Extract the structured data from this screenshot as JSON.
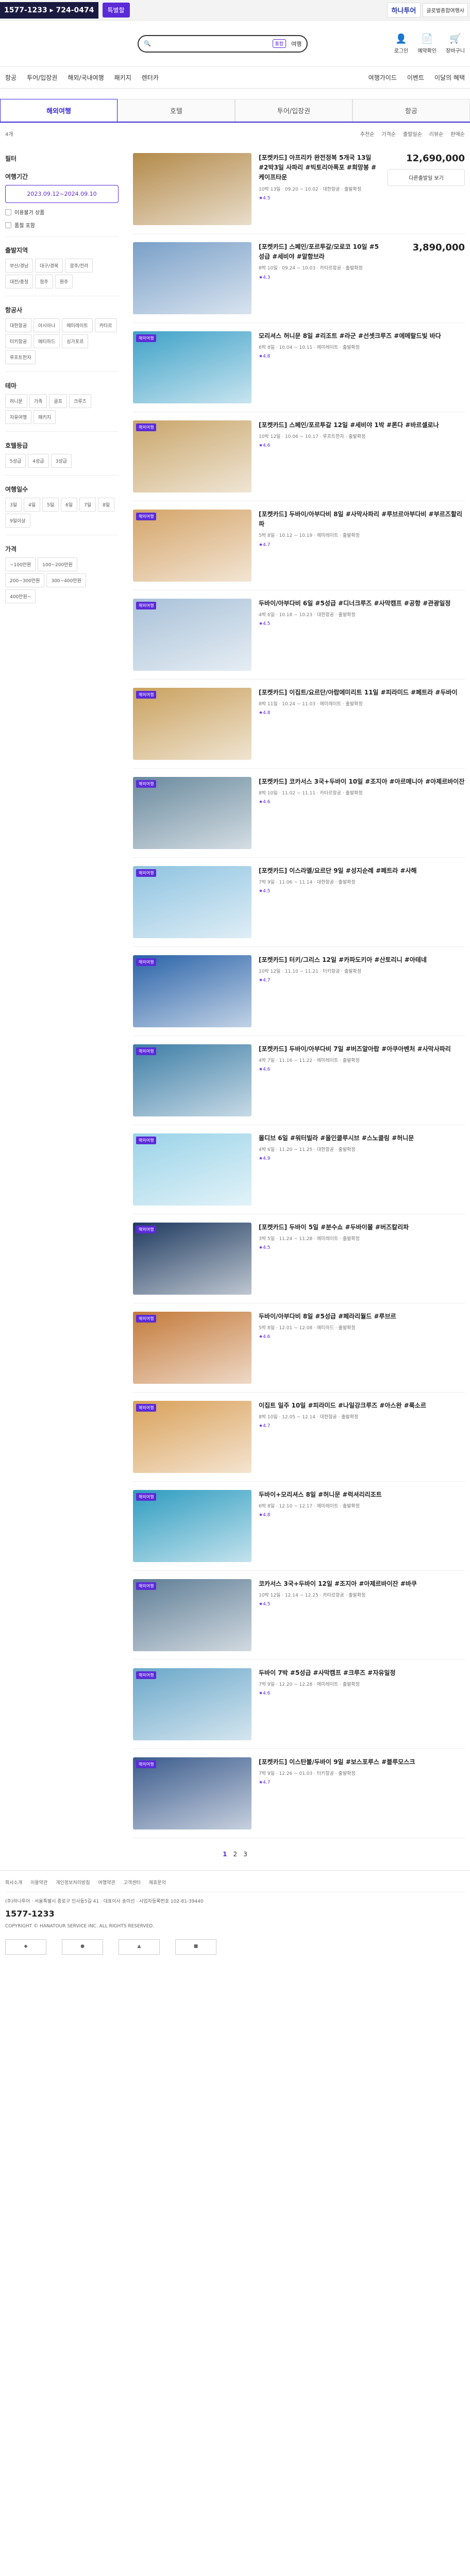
{
  "topbar": {
    "phone": "1577-1233 ▸ 724-0474",
    "special": "특별할",
    "hana": "하나투어",
    "corp": "글로벌종합여행사"
  },
  "header": {
    "search_placeholder": "",
    "mode": "통합",
    "mode_label": "여행",
    "icons": [
      {
        "name": "로그인",
        "icon": "user"
      },
      {
        "name": "예약확인",
        "icon": "doc"
      },
      {
        "name": "장바구니",
        "icon": "cart"
      }
    ]
  },
  "nav": {
    "left": [
      "항공",
      "투어/입장권",
      "해외/국내여행",
      "패키지",
      "렌터카"
    ],
    "right": [
      "여행가이드",
      "이벤트",
      "이달의 혜택"
    ]
  },
  "tabs": [
    "해외여행",
    "호텔",
    "투어/입장권",
    "항공"
  ],
  "breadcrumb": {
    "left": "4개",
    "right": [
      "추천순",
      "가격순",
      "출발일순",
      "리뷰순",
      "판매순"
    ]
  },
  "sidebar": {
    "title": "필터",
    "date_title": "여행기간",
    "date": "2023.09.12~2024.09.10",
    "exclude": "이용불가 상품",
    "soldout": "품절 포함",
    "region_title": "출발지역",
    "regions": [
      "부산/경남",
      "대구/경북",
      "광주/전라",
      "대전/충청",
      "청주",
      "원주"
    ],
    "airline_title": "항공사",
    "airlines": [
      "대한항공",
      "아시아나",
      "에미레이트",
      "카타르",
      "터키항공",
      "에티하드",
      "싱가포르",
      "루프트한자"
    ],
    "theme_title": "테마",
    "themes": [
      "허니문",
      "가족",
      "골프",
      "크루즈",
      "자유여행",
      "패키지"
    ],
    "hotel_title": "호텔등급",
    "hotels": [
      "5성급",
      "4성급",
      "3성급"
    ],
    "duration_title": "여행일수",
    "durations": [
      "3일",
      "4일",
      "5일",
      "6일",
      "7일",
      "8일",
      "9일이상"
    ],
    "price_title": "가격",
    "prices": [
      "~100만원",
      "100~200만원",
      "200~300만원",
      "300~400만원",
      "400만원~"
    ]
  },
  "cards": [
    {
      "title": "[포켓카드] 아프리카 완전정복 5개국 13일 #2박3일 사파리 #빅토리아폭포 #희망봉 #케이프타운",
      "meta": "10박 13일 · 09.20 ~ 10.02 · 대한항공 · 출발확정",
      "price": "12,690,000",
      "rate": "★4.5",
      "btn": "다른출발일 보기",
      "badge": "",
      "color": "#b38a4a"
    },
    {
      "title": "[포켓카드] 스페인/포르투갈/모로코 10일 #5성급 #세비야 #알함브라",
      "meta": "8박 10일 · 09.24 ~ 10.03 · 카타르항공 · 출발확정",
      "price": "3,890,000",
      "rate": "★4.3",
      "btn": "",
      "badge": "",
      "color": "#7aa0c8"
    },
    {
      "title": "모리셔스 허니문 8일 #리조트 #라군 #선셋크루즈 #에메랄드빛 바다",
      "meta": "6박 8일 · 10.04 ~ 10.11 · 에미레이트 · 출발확정",
      "price": "",
      "rate": "★4.8",
      "btn": "",
      "badge": "해외여행",
      "color": "#3fa2c8"
    },
    {
      "title": "[포켓카드] 스페인/포르투갈 12일 #세비야 1박 #론다 #바르셀로나",
      "meta": "10박 12일 · 10.06 ~ 10.17 · 루프트한자 · 출발확정",
      "price": "",
      "rate": "★4.6",
      "btn": "",
      "badge": "해외여행",
      "color": "#c9a66b"
    },
    {
      "title": "[포켓카드] 두바이/아부다비 8일 #사막사파리 #루브르아부다비 #부르즈할리파",
      "meta": "5박 8일 · 10.12 ~ 10.19 · 에미레이트 · 출발확정",
      "price": "",
      "rate": "★4.7",
      "btn": "",
      "badge": "해외여행",
      "color": "#d4a468"
    },
    {
      "title": "두바이/아부다비 6일 #5성급 #디너크루즈 #사막캠프 #공항 #관광일정",
      "meta": "4박 6일 · 10.18 ~ 10.23 · 대한항공 · 출발확정",
      "price": "",
      "rate": "★4.5",
      "btn": "",
      "badge": "해외여행",
      "color": "#a8c1d8"
    },
    {
      "title": "[포켓카드] 이집트/요르단/아랍에미리트 11일 #피라미드 #페트라 #두바이",
      "meta": "8박 11일 · 10.24 ~ 11.03 · 에미레이트 · 출발확정",
      "price": "",
      "rate": "★4.8",
      "btn": "",
      "badge": "해외여행",
      "color": "#c9a15e"
    },
    {
      "title": "[포켓카드] 코카서스 3국+두바이 10일 #조지아 #아르메니아 #아제르바이잔",
      "meta": "8박 10일 · 11.02 ~ 11.11 · 카타르항공 · 출발확정",
      "price": "",
      "rate": "★4.6",
      "btn": "",
      "badge": "해외여행",
      "color": "#6a8a9e"
    },
    {
      "title": "[포켓카드] 이스라엘/요르단 9일 #성지순례 #페트라 #사해",
      "meta": "7박 9일 · 11.06 ~ 11.14 · 대한항공 · 출발확정",
      "price": "",
      "rate": "★4.5",
      "btn": "",
      "badge": "해외여행",
      "color": "#8ec3e0"
    },
    {
      "title": "[포켓카드] 터키/그리스 12일 #카파도키아 #산토리니 #아테네",
      "meta": "10박 12일 · 11.10 ~ 11.21 · 터키항공 · 출발확정",
      "price": "",
      "rate": "★4.7",
      "btn": "",
      "badge": "해외여행",
      "color": "#2a63a8"
    },
    {
      "title": "[포켓카드] 두바이/아부다비 7일 #버즈알아랍 #아쿠아벤처 #사막사파리",
      "meta": "4박 7일 · 11.16 ~ 11.22 · 에미레이트 · 출발확정",
      "price": "",
      "rate": "★4.6",
      "btn": "",
      "badge": "해외여행",
      "color": "#3d7ea6"
    },
    {
      "title": "몰디브 6일 #워터빌라 #올인클루시브 #스노클링 #허니문",
      "meta": "4박 6일 · 11.20 ~ 11.25 · 대한항공 · 출발확정",
      "price": "",
      "rate": "★4.9",
      "btn": "",
      "badge": "해외여행",
      "color": "#9ad3e8"
    },
    {
      "title": "[포켓카드] 두바이 5일 #분수쇼 #두바이몰 #버즈칼리파",
      "meta": "3박 5일 · 11.24 ~ 11.28 · 에미레이트 · 출발확정",
      "price": "",
      "rate": "★4.5",
      "btn": "",
      "badge": "해외여행",
      "color": "#1e3a5f"
    },
    {
      "title": "두바이/아부다비 8일 #5성급 #페라리월드 #루브르",
      "meta": "5박 8일 · 12.01 ~ 12.08 · 에티하드 · 출발확정",
      "price": "",
      "rate": "★4.6",
      "btn": "",
      "badge": "해외여행",
      "color": "#c47a3a"
    },
    {
      "title": "이집트 일주 10일 #피라미드 #나일강크루즈 #아스완 #룩소르",
      "meta": "8박 10일 · 12.05 ~ 12.14 · 대한항공 · 출발확정",
      "price": "",
      "rate": "★4.7",
      "btn": "",
      "badge": "해외여행",
      "color": "#d9a15a"
    },
    {
      "title": "두바이+모리셔스 8일 #허니문 #럭셔리리조트",
      "meta": "6박 8일 · 12.10 ~ 12.17 · 에미레이트 · 출발확정",
      "price": "",
      "rate": "★4.8",
      "btn": "",
      "badge": "해외여행",
      "color": "#2e9cc0"
    },
    {
      "title": "코카서스 3국+두바이 12일 #조지아 #아제르바이잔 #바쿠",
      "meta": "10박 12일 · 12.14 ~ 12.25 · 카타르항공 · 출발확정",
      "price": "",
      "rate": "★4.5",
      "btn": "",
      "badge": "해외여행",
      "color": "#5f7d95"
    },
    {
      "title": "두바이 7박 #5성급 #사막캠프 #크루즈 #자유일정",
      "meta": "7박 9일 · 12.20 ~ 12.28 · 에미레이트 · 출발확정",
      "price": "",
      "rate": "★4.6",
      "btn": "",
      "badge": "해외여행",
      "color": "#6aa7c9"
    },
    {
      "title": "[포켓카드] 이스탄불/두바이 9일 #보스포루스 #블루모스크",
      "meta": "7박 9일 · 12.26 ~ 01.03 · 터키항공 · 출발확정",
      "price": "",
      "rate": "★4.7",
      "btn": "",
      "badge": "해외여행",
      "color": "#3b5b8c"
    }
  ],
  "pager": [
    "1",
    "2",
    "3"
  ],
  "footer": {
    "links": [
      "회사소개",
      "이용약관",
      "개인정보처리방침",
      "여행약관",
      "고객센터",
      "제휴문의"
    ],
    "info": "(주)하나투어 · 서울특별시 종로구 인사동5길 41 · 대표이사 송미선 · 사업자등록번호 102-81-39440",
    "phone": "1577-1233",
    "copyright": "COPYRIGHT © HANATOUR SERVICE INC. ALL RIGHTS RESERVED."
  }
}
